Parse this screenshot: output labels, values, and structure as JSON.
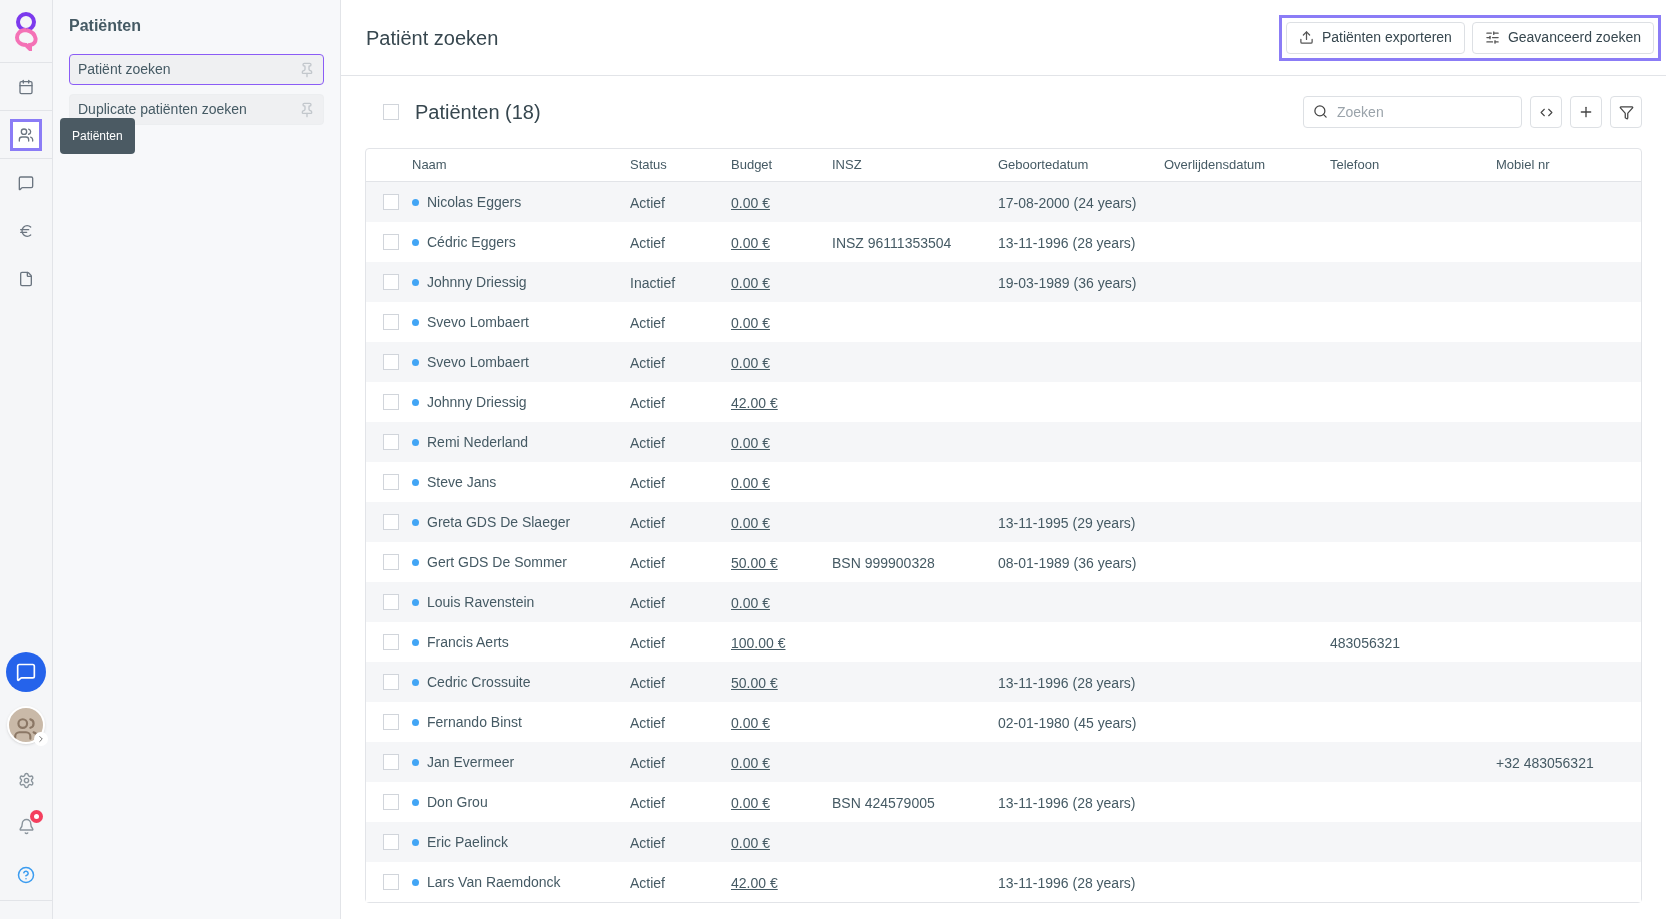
{
  "nav": [
    {
      "kind": "calendar",
      "selected": false
    },
    {
      "kind": "users",
      "selected": true
    },
    {
      "kind": "message",
      "selected": false
    },
    {
      "kind": "euro",
      "selected": false
    },
    {
      "kind": "file",
      "selected": false
    }
  ],
  "tooltip": "Patiënten",
  "notification_badge": true,
  "sidebar": {
    "title": "Patiënten",
    "items": [
      {
        "label": "Patiënt zoeken",
        "selected": true
      },
      {
        "label": "Duplicate patiënten zoeken",
        "selected": false
      }
    ]
  },
  "page_title": "Patiënt zoeken",
  "actions": [
    "Patiënten exporteren",
    "Geavanceerd zoeken"
  ],
  "list": {
    "title": "Patiënten (18)",
    "select_all": false,
    "search": {
      "placeholder": "Zoeken"
    }
  },
  "table": {
    "columns": [
      "Naam",
      "Status",
      "Budget",
      "INSZ",
      "Geboortedatum",
      "Overlijdensdatum",
      "Telefoon",
      "Mobiel nr"
    ],
    "rows": [
      {
        "checked": false,
        "cells": [
          "Nicolas Eggers",
          "Actief",
          "0.00 €",
          "",
          "17-08-2000 (24 years)",
          "",
          "",
          ""
        ]
      },
      {
        "checked": false,
        "cells": [
          "Cédric Eggers",
          "Actief",
          "0.00 €",
          "INSZ 96111353504",
          "13-11-1996 (28 years)",
          "",
          "",
          ""
        ]
      },
      {
        "checked": false,
        "cells": [
          "Johnny Driessig",
          "Inactief",
          "0.00 €",
          "",
          "19-03-1989 (36 years)",
          "",
          "",
          ""
        ]
      },
      {
        "checked": false,
        "cells": [
          "Svevo Lombaert",
          "Actief",
          "0.00 €",
          "",
          "",
          "",
          "",
          ""
        ]
      },
      {
        "checked": false,
        "cells": [
          "Svevo Lombaert",
          "Actief",
          "0.00 €",
          "",
          "",
          "",
          "",
          ""
        ]
      },
      {
        "checked": false,
        "cells": [
          "Johnny Driessig",
          "Actief",
          "42.00 €",
          "",
          "",
          "",
          "",
          ""
        ]
      },
      {
        "checked": false,
        "cells": [
          "Remi Nederland",
          "Actief",
          "0.00 €",
          "",
          "",
          "",
          "",
          ""
        ]
      },
      {
        "checked": false,
        "cells": [
          "Steve Jans",
          "Actief",
          "0.00 €",
          "",
          "",
          "",
          "",
          ""
        ]
      },
      {
        "checked": false,
        "cells": [
          "Greta GDS De Slaeger",
          "Actief",
          "0.00 €",
          "",
          "13-11-1995 (29 years)",
          "",
          "",
          ""
        ]
      },
      {
        "checked": false,
        "cells": [
          "Gert GDS De Sommer",
          "Actief",
          "50.00 €",
          "BSN 999900328",
          "08-01-1989 (36 years)",
          "",
          "",
          ""
        ]
      },
      {
        "checked": false,
        "cells": [
          "Louis Ravenstein",
          "Actief",
          "0.00 €",
          "",
          "",
          "",
          "",
          ""
        ]
      },
      {
        "checked": false,
        "cells": [
          "Francis Aerts",
          "Actief",
          "100.00 €",
          "",
          "",
          "",
          "483056321",
          ""
        ]
      },
      {
        "checked": false,
        "cells": [
          "Cedric Crossuite",
          "Actief",
          "50.00 €",
          "",
          "13-11-1996 (28 years)",
          "",
          "",
          ""
        ]
      },
      {
        "checked": false,
        "cells": [
          "Fernando Binst",
          "Actief",
          "0.00 €",
          "",
          "02-01-1980 (45 years)",
          "",
          "",
          ""
        ]
      },
      {
        "checked": false,
        "cells": [
          "Jan Evermeer",
          "Actief",
          "0.00 €",
          "",
          "",
          "",
          "",
          "+32 483056321"
        ]
      },
      {
        "checked": false,
        "cells": [
          "Don Grou",
          "Actief",
          "0.00 €",
          "BSN 424579005",
          "13-11-1996 (28 years)",
          "",
          "",
          ""
        ]
      },
      {
        "checked": false,
        "cells": [
          "Eric Paelinck",
          "Actief",
          "0.00 €",
          "",
          "",
          "",
          "",
          ""
        ]
      },
      {
        "checked": false,
        "cells": [
          "Lars Van Raemdonck",
          "Actief",
          "42.00 €",
          "",
          "13-11-1996 (28 years)",
          "",
          "",
          ""
        ]
      }
    ]
  }
}
